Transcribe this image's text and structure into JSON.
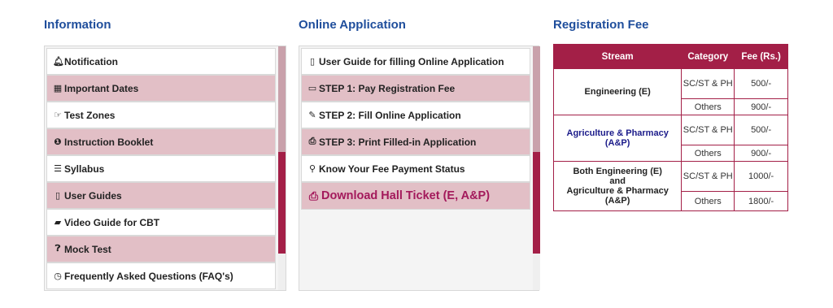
{
  "information": {
    "title": "Information",
    "items": [
      {
        "icon": "bell-icon",
        "glyph": "♫",
        "label": "Notification"
      },
      {
        "icon": "calendar-icon",
        "glyph": "▦",
        "label": "Important Dates"
      },
      {
        "icon": "hand-pointer-icon",
        "glyph": "☞",
        "label": "Test Zones"
      },
      {
        "icon": "info-circle-icon",
        "glyph": "❶",
        "label": "Instruction Booklet"
      },
      {
        "icon": "list-icon",
        "glyph": "☰",
        "label": "Syllabus"
      },
      {
        "icon": "file-icon",
        "glyph": "▯",
        "label": "User Guides"
      },
      {
        "icon": "book-icon",
        "glyph": "▰",
        "label": "Video Guide for CBT"
      },
      {
        "icon": "question-circle-icon",
        "glyph": "❓",
        "label": "Mock Test"
      },
      {
        "icon": "clock-icon",
        "glyph": "◷",
        "label": "Frequently Asked Questions (FAQ's)"
      }
    ]
  },
  "online_application": {
    "title": "Online Application",
    "items": [
      {
        "icon": "file-icon",
        "glyph": "▯",
        "label": "User Guide for filling Online Application"
      },
      {
        "icon": "credit-card-icon",
        "glyph": "▭",
        "label": "STEP 1: Pay Registration Fee"
      },
      {
        "icon": "edit-icon",
        "glyph": "✎",
        "label": "STEP 2: Fill Online Application"
      },
      {
        "icon": "print-icon",
        "glyph": "⎙",
        "label": "STEP 3: Print Filled-in Application"
      },
      {
        "icon": "search-icon",
        "glyph": "⚲",
        "label": "Know Your Fee Payment Status"
      },
      {
        "icon": "print-icon",
        "glyph": "⎙",
        "label": "Download Hall Ticket (E, A&P)"
      }
    ]
  },
  "registration_fee": {
    "title": "Registration Fee",
    "headers": [
      "Stream",
      "Category",
      "Fee (Rs.)"
    ],
    "streams": [
      {
        "name": "Engineering (E)",
        "rows": [
          {
            "category": "SC/ST & PH",
            "fee": "500/-"
          },
          {
            "category": "Others",
            "fee": "900/-"
          }
        ]
      },
      {
        "name": "Agriculture & Pharmacy (A&P)",
        "rows": [
          {
            "category": "SC/ST & PH",
            "fee": "500/-"
          },
          {
            "category": "Others",
            "fee": "900/-"
          }
        ]
      },
      {
        "name_lines": [
          "Both Engineering (E)",
          "and",
          "Agriculture & Pharmacy",
          "(A&P)"
        ],
        "rows": [
          {
            "category": "SC/ST & PH",
            "fee": "1000/-"
          },
          {
            "category": "Others",
            "fee": "1800/-"
          }
        ]
      }
    ]
  },
  "colors": {
    "accent": "#a31f47",
    "title_blue": "#1f4e9c",
    "row_pink": "#e2bfc6",
    "hall_ticket": "#a3195b",
    "stream_blue": "#1b1b8a"
  }
}
